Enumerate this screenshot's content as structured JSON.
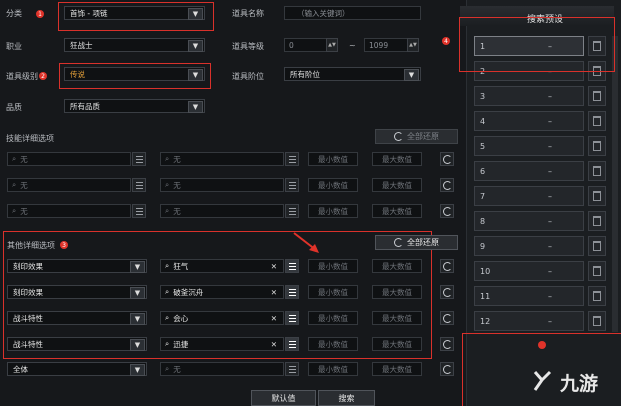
{
  "filters": {
    "category_label": "分类",
    "category_value": "首饰 - 项链",
    "job_label": "职业",
    "job_value": "狂战士",
    "grade_label": "道具级别",
    "grade_value": "传说",
    "quality_label": "品质",
    "quality_value": "所有品质",
    "item_name_label": "道具名称",
    "item_name_placeholder": "（输入关键词）",
    "item_level_label": "道具等级",
    "item_level_min": "0",
    "item_level_sep": "~",
    "item_level_max": "1099",
    "item_tier_label": "道具阶位",
    "item_tier_value": "所有阶位"
  },
  "skill_section": {
    "title": "技能详细选项",
    "reset_label": "全部还原",
    "rows": [
      {
        "left": "无",
        "right": "无",
        "min": "最小数值",
        "max": "最大数值"
      },
      {
        "left": "无",
        "right": "无",
        "min": "最小数值",
        "max": "最大数值"
      },
      {
        "left": "无",
        "right": "无",
        "min": "最小数值",
        "max": "最大数值"
      }
    ]
  },
  "other_section": {
    "title": "其他详细选项",
    "reset_label": "全部还原",
    "rows": [
      {
        "type": "刻印效果",
        "search": "狂气",
        "min": "最小数值",
        "max": "最大数值"
      },
      {
        "type": "刻印效果",
        "search": "破釜沉舟",
        "min": "最小数值",
        "max": "最大数值"
      },
      {
        "type": "战斗特性",
        "search": "会心",
        "min": "最小数值",
        "max": "最大数值"
      },
      {
        "type": "战斗特性",
        "search": "迅捷",
        "min": "最小数值",
        "max": "最大数值"
      }
    ],
    "last_row": {
      "type": "全体",
      "search": "无",
      "min": "最小数值",
      "max": "最大数值"
    }
  },
  "footer": {
    "default_label": "默认值",
    "search_label": "搜索"
  },
  "presets": {
    "title": "搜索预设",
    "items": [
      {
        "n": "1",
        "v": "–"
      },
      {
        "n": "2",
        "v": "–"
      },
      {
        "n": "3",
        "v": "–"
      },
      {
        "n": "4",
        "v": "–"
      },
      {
        "n": "5",
        "v": "–"
      },
      {
        "n": "6",
        "v": "–"
      },
      {
        "n": "7",
        "v": "–"
      },
      {
        "n": "8",
        "v": "–"
      },
      {
        "n": "9",
        "v": "–"
      },
      {
        "n": "10",
        "v": "–"
      },
      {
        "n": "11",
        "v": "–"
      },
      {
        "n": "12",
        "v": "–"
      }
    ]
  },
  "annotations": {
    "b1": "1",
    "b2": "2",
    "b3": "3",
    "b4": "4"
  },
  "watermark": "九游",
  "colors": {
    "accent_red": "#e0332a",
    "legend_orange": "#e8a33a"
  }
}
